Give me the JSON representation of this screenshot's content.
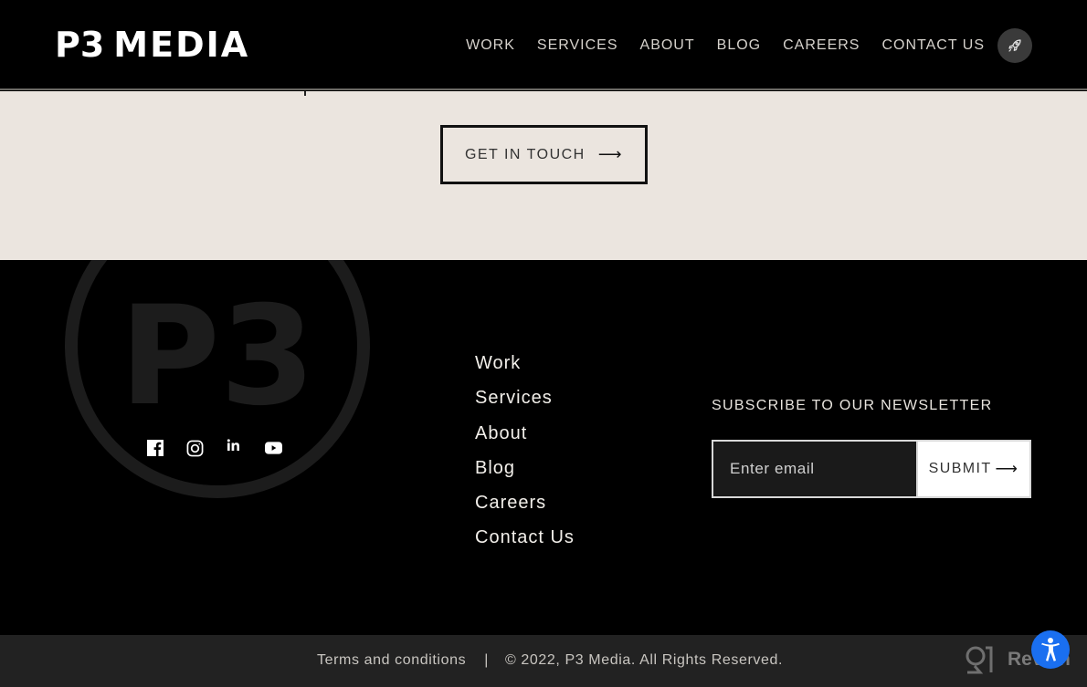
{
  "header": {
    "logo": {
      "part1": "P3",
      "part2": "MEDIA"
    },
    "nav": [
      {
        "label": "WORK"
      },
      {
        "label": "SERVICES"
      },
      {
        "label": "ABOUT"
      },
      {
        "label": "BLOG"
      },
      {
        "label": "CAREERS"
      },
      {
        "label": "CONTACT US"
      }
    ],
    "launch_icon": "rocket-icon"
  },
  "cta": {
    "button_label": "GET IN TOUCH",
    "button_arrow": "⟶"
  },
  "footer": {
    "background_logo_text": "P3",
    "social": [
      {
        "name": "facebook",
        "icon": "facebook-icon"
      },
      {
        "name": "instagram",
        "icon": "instagram-icon"
      },
      {
        "name": "linkedin",
        "icon": "linkedin-icon"
      },
      {
        "name": "youtube",
        "icon": "youtube-icon"
      }
    ],
    "links": [
      {
        "label": "Work"
      },
      {
        "label": "Services"
      },
      {
        "label": "About"
      },
      {
        "label": "Blog"
      },
      {
        "label": "Careers"
      },
      {
        "label": "Contact Us"
      }
    ],
    "newsletter": {
      "title": "SUBSCRIBE TO OUR NEWSLETTER",
      "email_value": "",
      "email_placeholder": "Enter email",
      "submit_label": "SUBMIT",
      "submit_arrow": "⟶"
    }
  },
  "bottom": {
    "terms_label": "Terms and conditions",
    "separator": "|",
    "copyright": "© 2022, P3 Media. All Rights Reserved.",
    "revain_label": "Revain",
    "accessibility_icon": "accessibility-icon"
  },
  "colors": {
    "header_bg": "#000000",
    "cta_bg": "#ebe5df",
    "footer_bg": "#000000",
    "bottom_bg": "#222222",
    "accessibility_blue": "#1a6ff0",
    "bg_logo_gray": "#1c1c1c"
  }
}
